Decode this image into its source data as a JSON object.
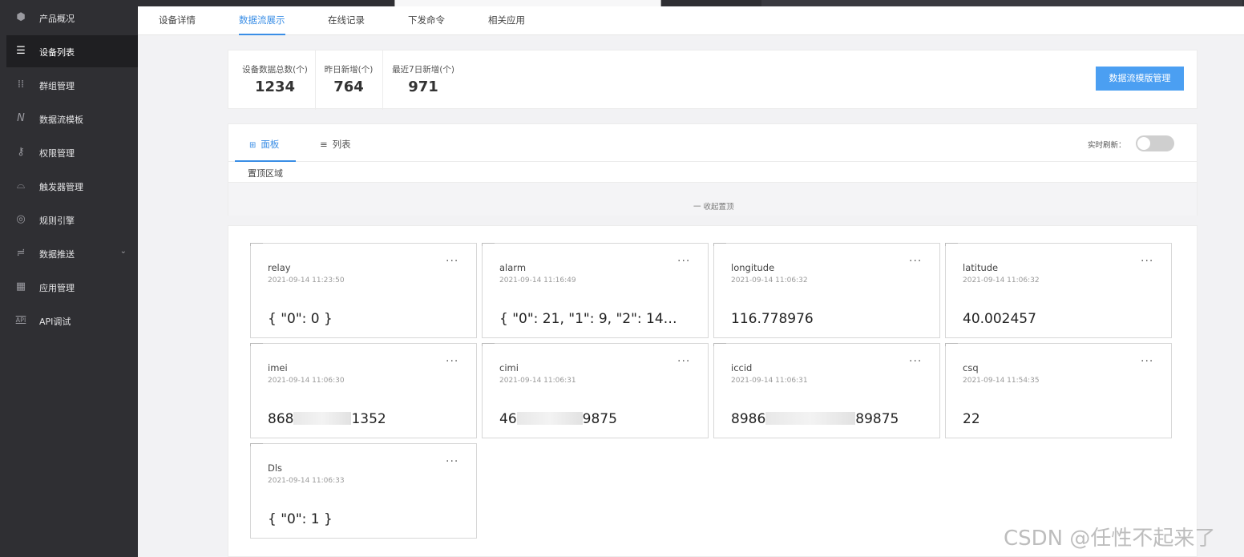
{
  "sidebar": {
    "items": [
      {
        "label": "产品概况",
        "icon": "cube-icon",
        "glyph": "⬢",
        "active": false
      },
      {
        "label": "设备列表",
        "icon": "list-icon",
        "glyph": "☰",
        "active": true
      },
      {
        "label": "群组管理",
        "icon": "grid-dots-icon",
        "glyph": "⁞⁞",
        "active": false
      },
      {
        "label": "数据流模板",
        "icon": "data-flow-icon",
        "glyph": "N",
        "active": false
      },
      {
        "label": "权限管理",
        "icon": "key-icon",
        "glyph": "⚷",
        "active": false
      },
      {
        "label": "触发器管理",
        "icon": "trigger-icon",
        "glyph": "⌓",
        "active": false
      },
      {
        "label": "规则引擎",
        "icon": "engine-icon",
        "glyph": "◎",
        "active": false
      },
      {
        "label": "数据推送",
        "icon": "push-icon",
        "glyph": "≓",
        "active": false,
        "has_children": true
      },
      {
        "label": "应用管理",
        "icon": "apps-icon",
        "glyph": "▦",
        "active": false
      },
      {
        "label": "API调试",
        "icon": "api-icon",
        "glyph": "API",
        "active": false
      }
    ]
  },
  "tabs": [
    {
      "label": "设备详情",
      "active": false
    },
    {
      "label": "数据流展示",
      "active": true
    },
    {
      "label": "在线记录",
      "active": false
    },
    {
      "label": "下发命令",
      "active": false
    },
    {
      "label": "相关应用",
      "active": false
    }
  ],
  "stats": {
    "items": [
      {
        "label": "设备数据总数(个)",
        "value": "1234"
      },
      {
        "label": "昨日新增(个)",
        "value": "764"
      },
      {
        "label": "最近7日新增(个)",
        "value": "971"
      }
    ],
    "manage_button": "数据流模版管理"
  },
  "panel": {
    "view_tabs": [
      {
        "label": "面板",
        "icon": "grid-icon",
        "glyph": "⊞",
        "active": true
      },
      {
        "label": "列表",
        "icon": "list-lines-icon",
        "glyph": "≡",
        "active": false
      }
    ],
    "refresh_label": "实时刷新：",
    "realtime_refresh": false,
    "pinned_title": "置顶区域",
    "collapse_label": "一 收起置顶"
  },
  "cards": [
    {
      "name": "relay",
      "time": "2021-09-14 11:23:50",
      "value": "{ \"0\": 0 }"
    },
    {
      "name": "alarm",
      "time": "2021-09-14 11:16:49",
      "value": "{ \"0\": 21, \"1\": 9, \"2\": 14…"
    },
    {
      "name": "longitude",
      "time": "2021-09-14 11:06:32",
      "value": "116.778976"
    },
    {
      "name": "latitude",
      "time": "2021-09-14 11:06:32",
      "value": "40.002457"
    },
    {
      "name": "imei",
      "time": "2021-09-14 11:06:30",
      "value_prefix": "868",
      "value_suffix": "1352",
      "masked": true
    },
    {
      "name": "cimi",
      "time": "2021-09-14 11:06:31",
      "value_prefix": "46",
      "value_suffix": "9875",
      "masked": true
    },
    {
      "name": "iccid",
      "time": "2021-09-14 11:06:31",
      "value_prefix": "8986",
      "value_suffix": "89875",
      "masked": true
    },
    {
      "name": "csq",
      "time": "2021-09-14 11:54:35",
      "value": "22"
    },
    {
      "name": "Dls",
      "time": "2021-09-14 11:06:33",
      "value": "{ \"0\": 1 }"
    }
  ],
  "more_glyph": "···",
  "watermark": "CSDN @任性不起来了",
  "colors": {
    "accent": "#3a8ee6",
    "sidebar_bg": "#2f2f33",
    "button": "#4b9ff2"
  }
}
